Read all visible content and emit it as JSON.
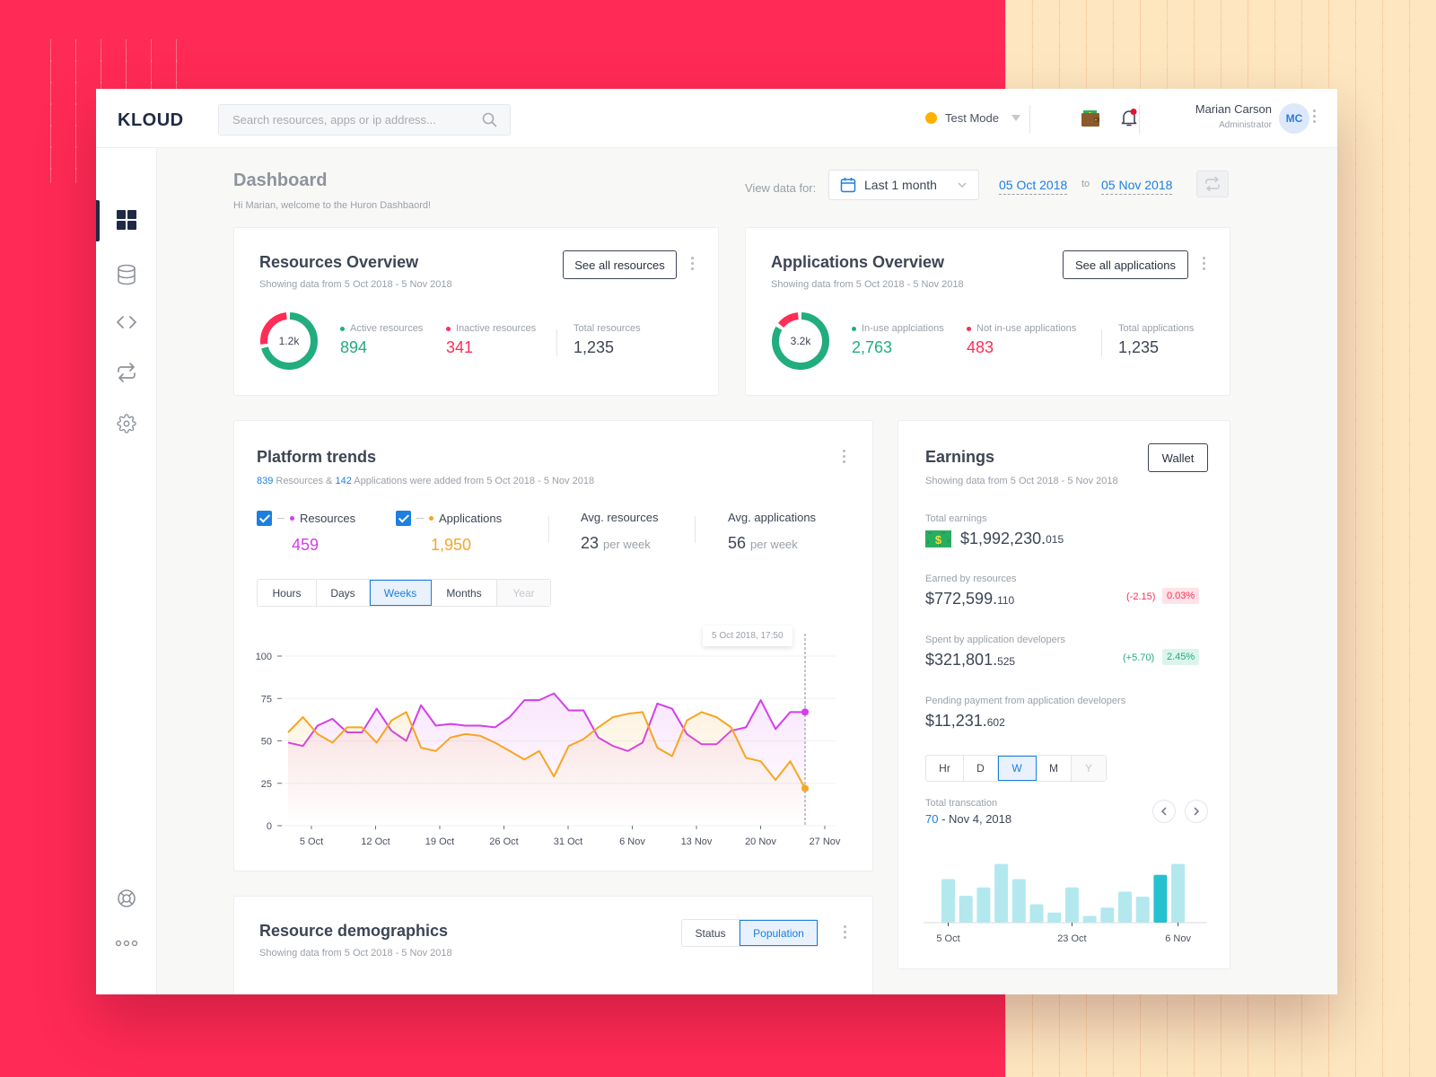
{
  "header": {
    "logo": "KLOUD",
    "search_placeholder": "Search resources, apps or ip address...",
    "mode_label": "Test Mode",
    "user_name": "Marian Carson",
    "user_role": "Administrator",
    "user_initials": "MC"
  },
  "colors": {
    "accent": "#1d7fe0",
    "green": "#22ad7d",
    "red": "#ff2d55",
    "purple": "#d33eea",
    "orange": "#f5a623",
    "bar": "#b3e8ee",
    "bar_active": "#26c1d0"
  },
  "sidebar": {
    "items": [
      {
        "name": "dashboard",
        "icon": "grid-icon",
        "active": true
      },
      {
        "name": "database",
        "icon": "database-icon",
        "active": false
      },
      {
        "name": "code",
        "icon": "code-icon",
        "active": false
      },
      {
        "name": "transfers",
        "icon": "repeat-icon",
        "active": false
      },
      {
        "name": "settings",
        "icon": "gear-icon",
        "active": false
      }
    ],
    "bottom": [
      {
        "name": "support",
        "icon": "lifebuoy-icon"
      },
      {
        "name": "more",
        "icon": "more-horizontal-icon"
      }
    ]
  },
  "page": {
    "title": "Dashboard",
    "subtitle": "Hi Marian, welcome to the Huron Dashbaord!",
    "view_label": "View data for:",
    "range_value": "Last 1 month",
    "date_from": "05 Oct 2018",
    "date_to_label": "to",
    "date_to": "05 Nov 2018"
  },
  "resources_overview": {
    "title": "Resources Overview",
    "subtitle": "Showing data from 5 Oct 2018 - 5 Nov 2018",
    "button": "See all resources",
    "donut_label": "1.2k",
    "active_fraction": 0.724,
    "stats": [
      {
        "label": "Active resources",
        "value": "894"
      },
      {
        "label": "Inactive resources",
        "value": "341"
      },
      {
        "label": "Total resources",
        "value": "1,235"
      }
    ]
  },
  "applications_overview": {
    "title": "Applications Overview",
    "subtitle": "Showing data from 5 Oct 2018 - 5 Nov 2018",
    "button": "See all applications",
    "donut_label": "3.2k",
    "active_fraction": 0.851,
    "stats": [
      {
        "label": "In-use applciations",
        "value": "2,763"
      },
      {
        "label": "Not in-use applications",
        "value": "483"
      },
      {
        "label": "Total applications",
        "value": "1,235"
      }
    ]
  },
  "platform_trends": {
    "title": "Platform trends",
    "sub_resources_count": "839",
    "sub_mid": " Resources & ",
    "sub_apps_count": "142",
    "sub_tail": " Applications were added from 5 Oct 2018 - 5 Nov 2018",
    "legend": [
      {
        "label": "Resources",
        "value": "459",
        "checked": true
      },
      {
        "label": "Applications",
        "value": "1,950",
        "checked": true
      }
    ],
    "avg": [
      {
        "label": "Avg. resources",
        "value": "23",
        "unit": "per week"
      },
      {
        "label": "Avg. applications",
        "value": "56",
        "unit": "per week"
      }
    ],
    "periods": [
      {
        "label": "Hours",
        "state": "normal"
      },
      {
        "label": "Days",
        "state": "normal"
      },
      {
        "label": "Weeks",
        "state": "selected"
      },
      {
        "label": "Months",
        "state": "normal"
      },
      {
        "label": "Year",
        "state": "disabled"
      }
    ],
    "tooltip": "5 Oct 2018, 17:50"
  },
  "earnings": {
    "title": "Earnings",
    "subtitle": "Showing data from 5 Oct 2018 - 5 Nov 2018",
    "button": "Wallet",
    "total_label": "Total earnings",
    "total_main": "$1,992,230.",
    "total_dec": "015",
    "rows": [
      {
        "label": "Earned by resources",
        "main": "$772,599.",
        "dec": "110",
        "change": "(-2.15)",
        "pct": "0.03%",
        "trend": "down"
      },
      {
        "label": "Spent by application developers",
        "main": "$321,801.",
        "dec": "525",
        "change": "(+5.70)",
        "pct": "2.45%",
        "trend": "up"
      },
      {
        "label": "Pending payment from application developers",
        "main": "$11,231.",
        "dec": "602"
      }
    ],
    "periods": [
      {
        "label": "Hr",
        "state": "normal"
      },
      {
        "label": "D",
        "state": "normal"
      },
      {
        "label": "W",
        "state": "selected"
      },
      {
        "label": "M",
        "state": "normal"
      },
      {
        "label": "Y",
        "state": "disabled"
      }
    ],
    "transaction_label": "Total transcation",
    "transaction_count": "70",
    "transaction_date": " - Nov 4, 2018"
  },
  "resource_demographics": {
    "title": "Resource demographics",
    "subtitle": "Showing data from 5 Oct 2018 - 5 Nov 2018",
    "toggle": [
      {
        "label": "Status",
        "state": "normal"
      },
      {
        "label": "Population",
        "state": "selected"
      }
    ]
  },
  "chart_data": [
    {
      "type": "line",
      "title": "Platform trends",
      "xlabel": "",
      "ylabel": "",
      "ylim": [
        0,
        100
      ],
      "yticks": [
        0,
        25,
        50,
        75,
        100
      ],
      "xtick_labels": [
        "5 Oct",
        "12 Oct",
        "19 Oct",
        "26 Oct",
        "31 Oct",
        "6 Nov",
        "13 Nov",
        "20 Nov",
        "27 Nov"
      ],
      "grid": true,
      "series": [
        {
          "name": "Resources",
          "color": "#d33eea",
          "values": [
            49,
            47,
            59,
            63,
            55,
            55,
            69,
            56,
            50,
            71,
            59,
            60,
            59,
            59,
            58,
            64,
            74,
            74,
            78,
            68,
            68,
            52,
            47,
            44,
            49,
            72,
            69,
            54,
            48,
            48,
            56,
            58,
            74,
            57,
            67,
            67
          ]
        },
        {
          "name": "Applications",
          "color": "#f5a623",
          "values": [
            55,
            64,
            54,
            49,
            58,
            58,
            49,
            62,
            67,
            46,
            44,
            52,
            54,
            53,
            49,
            44,
            39,
            44,
            29,
            47,
            51,
            58,
            64,
            66,
            67,
            46,
            41,
            62,
            67,
            64,
            58,
            40,
            38,
            27,
            38,
            22
          ]
        }
      ]
    },
    {
      "type": "bar",
      "title": "Total transcation",
      "xtick_labels": [
        "5 Oct",
        "23 Oct",
        "6 Nov"
      ],
      "values": [
        52,
        32,
        42,
        70,
        52,
        22,
        12,
        42,
        8,
        18,
        37,
        31,
        57,
        70
      ],
      "highlight_index": 12,
      "ylim": [
        0,
        75
      ]
    }
  ]
}
